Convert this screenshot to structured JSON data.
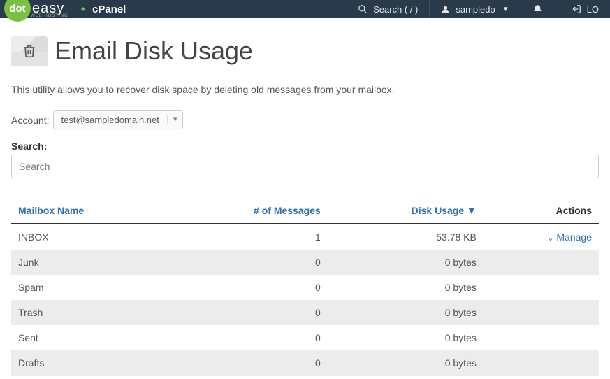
{
  "header": {
    "logo_primary": "dot",
    "logo_secondary": "easy",
    "logo_sub": "WEB HOSTING",
    "brand": "cPanel",
    "search_placeholder": "Search ( / )",
    "username": "sampledo",
    "logout": "LO"
  },
  "page": {
    "title": "Email Disk Usage",
    "description": "This utility allows you to recover disk space by deleting old messages from your mailbox.",
    "account_label": "Account:",
    "account_value": "test@sampledomain.net",
    "search_label": "Search:",
    "search_placeholder": "Search"
  },
  "table": {
    "headers": {
      "name": "Mailbox Name",
      "messages": "# of Messages",
      "usage": "Disk Usage ▼",
      "actions": "Actions"
    },
    "manage_label": "Manage",
    "rows": [
      {
        "name": "INBOX",
        "messages": "1",
        "usage": "53.78 KB",
        "manage": true
      },
      {
        "name": "Junk",
        "messages": "0",
        "usage": "0 bytes",
        "manage": false
      },
      {
        "name": "Spam",
        "messages": "0",
        "usage": "0 bytes",
        "manage": false
      },
      {
        "name": "Trash",
        "messages": "0",
        "usage": "0 bytes",
        "manage": false
      },
      {
        "name": "Sent",
        "messages": "0",
        "usage": "0 bytes",
        "manage": false
      },
      {
        "name": "Drafts",
        "messages": "0",
        "usage": "0 bytes",
        "manage": false
      }
    ]
  }
}
